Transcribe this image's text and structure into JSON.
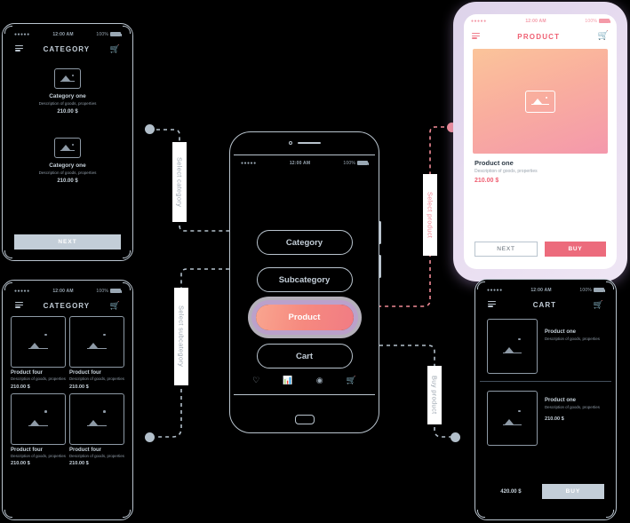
{
  "status_bar": {
    "carrier": "●●●●●",
    "time": "12:00 AM",
    "battery": "100%"
  },
  "colors": {
    "accent_pink": "#ef5f72",
    "accent_salmon": "#f6897f",
    "frame_grey": "#b9c4ce",
    "text_grey": "#8e9aa6",
    "purple_glow": "#c196d8"
  },
  "screens": {
    "category_list": {
      "title": "CATEGORY",
      "menu_icon": "hamburger-icon",
      "cart_icon": "cart-icon",
      "items": [
        {
          "name": "Category one",
          "desc": "Description of goods, properties",
          "price": "210.00 $",
          "image": "image-placeholder-icon"
        },
        {
          "name": "Category one",
          "desc": "Description of goods, properties",
          "price": "210.00 $",
          "image": "image-placeholder-icon"
        }
      ],
      "next_label": "NEXT"
    },
    "category_grid": {
      "title": "CATEGORY",
      "menu_icon": "hamburger-icon",
      "cart_icon": "cart-icon",
      "items": [
        {
          "name": "Product four",
          "desc": "Description of goods, properties",
          "price": "210.00 $",
          "image": "image-placeholder-icon"
        },
        {
          "name": "Product four",
          "desc": "Description of goods, properties",
          "price": "210.00 $",
          "image": "image-placeholder-icon"
        },
        {
          "name": "Product four",
          "desc": "Description of goods, properties",
          "price": "210.00 $",
          "image": "image-placeholder-icon"
        },
        {
          "name": "Product four",
          "desc": "Description of goods, properties",
          "price": "210.00 $",
          "image": "image-placeholder-icon"
        }
      ]
    },
    "product": {
      "title": "PRODUCT",
      "menu_icon": "hamburger-icon",
      "cart_icon": "cart-icon",
      "hero_image": "image-placeholder-icon",
      "name": "Product one",
      "desc": "Description of goods, properties",
      "price": "210.00 $",
      "next_label": "NEXT",
      "buy_label": "BUY"
    },
    "cart": {
      "title": "CART",
      "menu_icon": "hamburger-icon",
      "cart_icon": "cart-icon",
      "items": [
        {
          "name": "Product one",
          "desc": "Description of goods, properties",
          "price": "",
          "image": "image-placeholder-icon"
        },
        {
          "name": "Product one",
          "desc": "Description of goods, properties",
          "price": "210.00 $",
          "image": "image-placeholder-icon"
        }
      ],
      "total": "420.00 $",
      "buy_label": "BUY"
    }
  },
  "center_phone": {
    "menu": [
      {
        "label": "Category",
        "active": false
      },
      {
        "label": "Subcategory",
        "active": false
      },
      {
        "label": "Product",
        "active": true
      },
      {
        "label": "Cart",
        "active": false
      }
    ],
    "bottom_nav": [
      {
        "icon": "heart-icon",
        "glyph": "♡"
      },
      {
        "icon": "chart-icon",
        "glyph": "ᵛ"
      },
      {
        "icon": "settings-icon",
        "glyph": "◎"
      },
      {
        "icon": "cart-icon",
        "glyph": "ᵛ"
      }
    ]
  },
  "connectors": [
    {
      "label": "Select category",
      "color": "grey"
    },
    {
      "label": "Select subcategory",
      "color": "grey"
    },
    {
      "label": "Select product",
      "color": "pink"
    },
    {
      "label": "Buy product",
      "color": "grey"
    }
  ]
}
